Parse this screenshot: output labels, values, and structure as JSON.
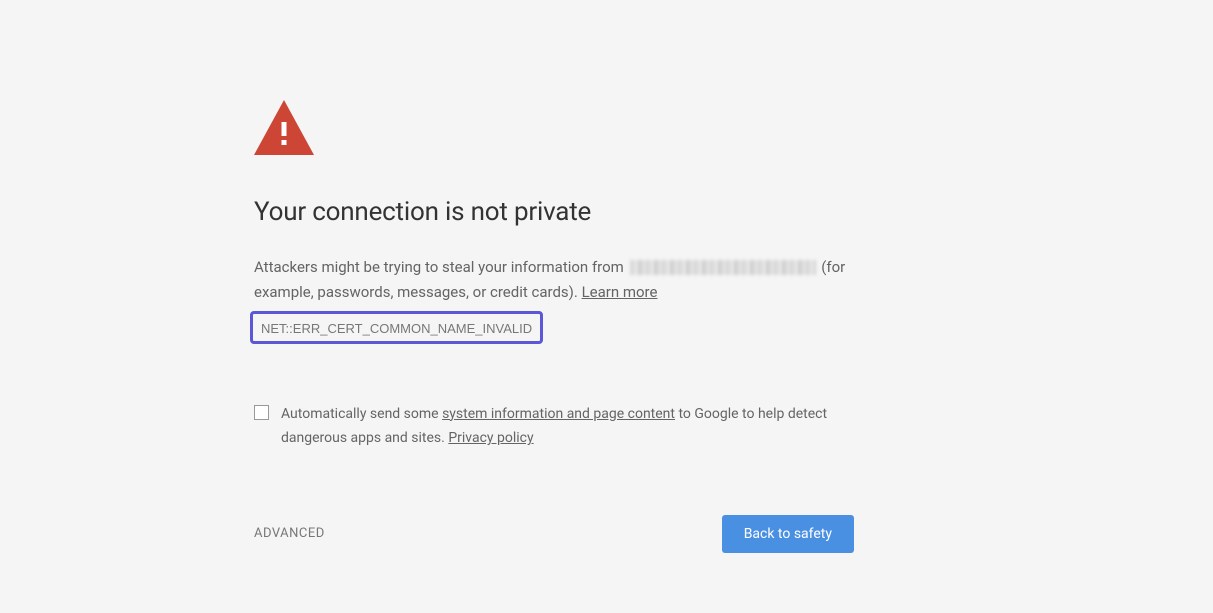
{
  "heading": "Your connection is not private",
  "body": {
    "prefix": "Attackers might be trying to steal your information from ",
    "suffix_paren": " (for example, passwords, messages, or credit cards). ",
    "learn_more": "Learn more"
  },
  "error_code": "NET::ERR_CERT_COMMON_NAME_INVALID",
  "reporting": {
    "prefix": "Automatically send some ",
    "link1": "system information and page content",
    "mid": " to Google to help detect dangerous apps and sites. ",
    "link2": "Privacy policy"
  },
  "buttons": {
    "advanced": "ADVANCED",
    "back_to_safety": "Back to safety"
  },
  "colors": {
    "danger_red": "#cc4535",
    "highlight_border": "#5b57d6",
    "primary_button": "#4a90e2"
  }
}
